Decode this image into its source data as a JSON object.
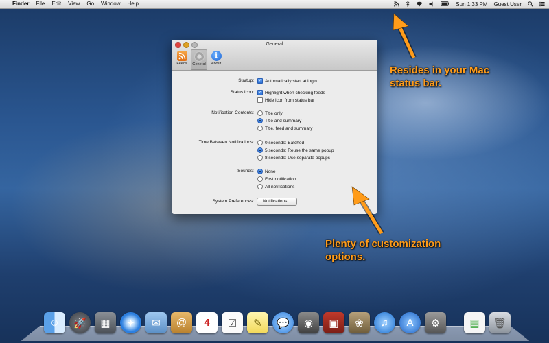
{
  "menubar": {
    "apple": "",
    "items": [
      "Finder",
      "File",
      "Edit",
      "View",
      "Go",
      "Window",
      "Help"
    ],
    "clock": "Sun 1:33 PM",
    "user": "Guest User"
  },
  "window": {
    "title": "General",
    "tabs": [
      {
        "label": "Feeds",
        "icon": "rss-feed-icon"
      },
      {
        "label": "General",
        "icon": "gear-icon"
      },
      {
        "label": "About",
        "icon": "info-icon"
      }
    ],
    "startup": {
      "label": "Startup:",
      "opt": "Automatically start at login",
      "checked": true
    },
    "status_icon": {
      "label": "Status Icon:",
      "opt1": "Highlight when checking feeds",
      "opt1_checked": true,
      "opt2": "Hide icon from status bar",
      "opt2_checked": false
    },
    "notification_contents": {
      "label": "Notification Contents:",
      "options": [
        "Title only",
        "Title and summary",
        "Title, feed and summary"
      ],
      "selected": 1
    },
    "time_between": {
      "label": "Time Between Notifications:",
      "options": [
        "0 seconds: Batched",
        "5 seconds: Reuse the same popup",
        "8 seconds: Use separate popups"
      ],
      "selected": 1
    },
    "sounds": {
      "label": "Sounds:",
      "options": [
        "None",
        "First notification",
        "All notifications"
      ],
      "selected": 0
    },
    "system_prefs": {
      "label": "System Preferences:",
      "button": "Notifications..."
    }
  },
  "annotations": {
    "top_line1": "Resides in your Mac",
    "top_line2": "status bar.",
    "bottom_line1": "Plenty of customization",
    "bottom_line2": "options."
  },
  "colors": {
    "accent": "#ff9c1a",
    "selection": "#2d6fd4"
  }
}
